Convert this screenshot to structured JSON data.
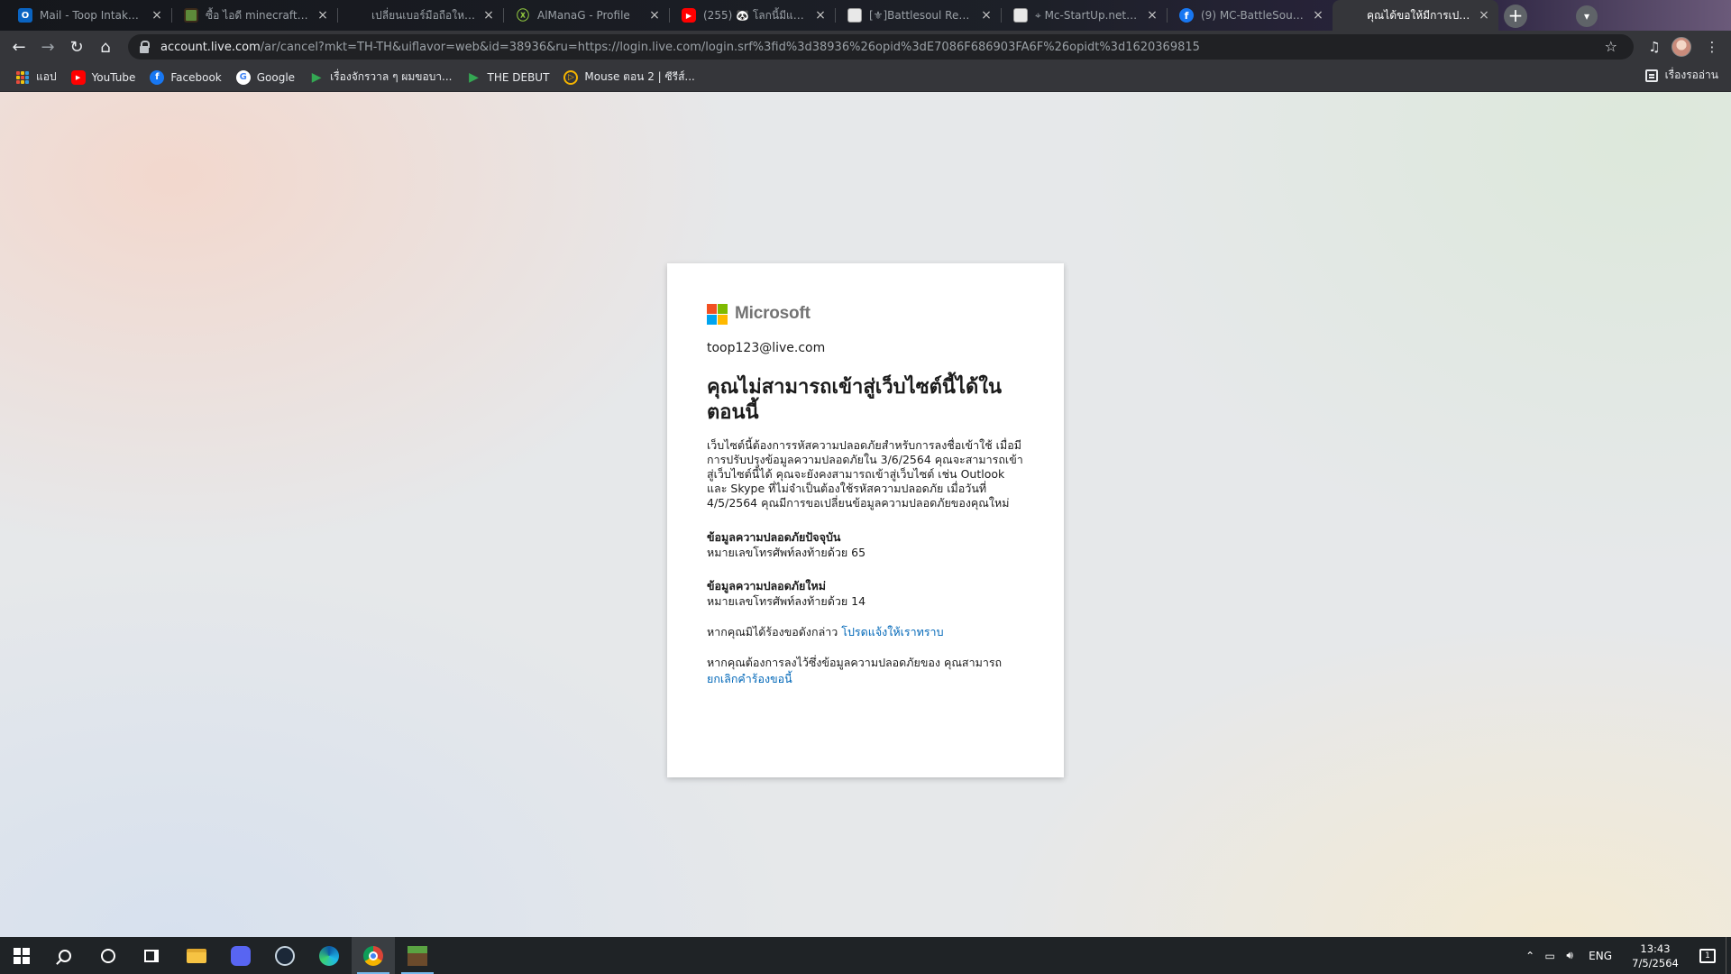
{
  "browser": {
    "tabs": [
      {
        "title": "Mail - Toop Intaksin - ",
        "icon": "outlook-icon"
      },
      {
        "title": "ซื้อ ไอดี minecraft จะเก็บ",
        "icon": "minecraft-block-icon"
      },
      {
        "title": "เปลี่ยนเบอร์มือถือใหม่ ให้คุ",
        "icon": "microsoft-icon"
      },
      {
        "title": "AlManaG - Profile",
        "icon": "xbox-icon"
      },
      {
        "title": "(255) 🐼 โลกนี้มีแต่เรื่",
        "icon": "youtube-icon"
      },
      {
        "title": "[⚜]Battlesoul Retur",
        "icon": "image-icon"
      },
      {
        "title": "⌖ Mc-StartUp.net ⌖ · ",
        "icon": "image-icon"
      },
      {
        "title": "(9) MC-BattleSoul Mi",
        "icon": "facebook-icon"
      },
      {
        "title": "คุณได้ขอให้มีการเปลี่ยนแ",
        "icon": "microsoft-icon",
        "active": true
      }
    ],
    "new_tab_label": "+",
    "url_host": "account.live.com",
    "url_rest": "/ar/cancel?mkt=TH-TH&uiflavor=web&id=38936&ru=https://login.live.com/login.srf%3fid%3d38936%26opid%3dE7086F686903FA6F%26opidt%3d1620369815",
    "bookmarks": [
      {
        "label": "แอป",
        "icon": "apps-grid-icon"
      },
      {
        "label": "YouTube",
        "icon": "youtube-icon"
      },
      {
        "label": "Facebook",
        "icon": "facebook-icon"
      },
      {
        "label": "Google",
        "icon": "google-icon"
      },
      {
        "label": "เรื่องจักรวาล ๆ ผมขอบา...",
        "icon": "play-icon"
      },
      {
        "label": "THE DEBUT",
        "icon": "play-icon"
      },
      {
        "label": "Mouse ตอน 2 | ซีรีส์...",
        "icon": "mouse-icon"
      }
    ],
    "reading_list": "เรื่องรออ่าน"
  },
  "page": {
    "brand": "Microsoft",
    "account": "toop123@live.com",
    "heading": "คุณไม่สามารถเข้าสู่เว็บไซต์นี้ได้ในตอนนี้",
    "description": "เว็บไซต์นี้ต้องการรหัสความปลอดภัยสำหรับการลงชื่อเข้าใช้ เมื่อมีการปรับปรุงข้อมูลความปลอดภัยใน 3/6/2564 คุณจะสามารถเข้าสู่เว็บไซต์นี้ได้ คุณจะยังคงสามารถเข้าสู่เว็บไซต์ เช่น Outlook และ Skype ที่ไม่จำเป็นต้องใช้รหัสความปลอดภัย เมื่อวันที่ 4/5/2564 คุณมีการขอเปลี่ยนข้อมูลความปลอดภัยของคุณใหม่",
    "current_label": "ข้อมูลความปลอดภัยปัจจุบัน",
    "current_value": "หมายเลขโทรศัพท์ลงท้ายด้วย 65",
    "new_label": "ข้อมูลความปลอดภัยใหม่",
    "new_value": "หมายเลขโทรศัพท์ลงท้ายด้วย 14",
    "not_requested_text": "หากคุณมิได้ร้องขอดังกล่าว ",
    "notify_link": "โปรดแจ้งให้เราทราบ",
    "keep_text": "หากคุณต้องการลงไว้ซึ่งข้อมูลความปลอดภัยของ คุณสามารถ",
    "cancel_link": "ยกเลิกคำร้องขอนี้"
  },
  "taskbar": {
    "language": "ENG",
    "time": "13:43",
    "date": "7/5/2564",
    "notifications": "1",
    "pinned": [
      "start",
      "search",
      "cortana",
      "task-view",
      "file-explorer",
      "discord",
      "steam",
      "edge",
      "chrome",
      "minecraft"
    ]
  },
  "colors": {
    "ms_red": "#f25022",
    "ms_green": "#7fba00",
    "ms_blue": "#00a4ef",
    "ms_yellow": "#ffb900",
    "link": "#0067b8"
  }
}
